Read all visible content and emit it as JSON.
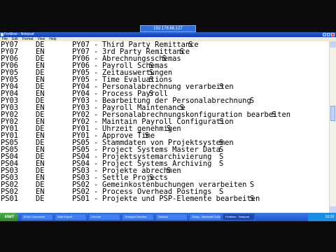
{
  "remote_session": {
    "title": "192.178.68.127"
  },
  "window": {
    "title": "Fertiliser - Notepad",
    "menus": [
      "File",
      "Edit",
      "Format",
      "View",
      "Help"
    ]
  },
  "rows": [
    {
      "code": "PY07",
      "lang": "DE",
      "code2": "PY07",
      "desc": "Third Party Remittance",
      "flag": "S",
      "flag_col": 43
    },
    {
      "code": "PY07",
      "lang": "EN",
      "code2": "PY07",
      "desc": "3rd Party Remittance",
      "flag": "S",
      "flag_col": 41
    },
    {
      "code": "PY06",
      "lang": "DE",
      "code2": "PY06",
      "desc": "Abrechnungsschemas",
      "flag": "S",
      "flag_col": 37
    },
    {
      "code": "PY06",
      "lang": "EN",
      "code2": "PY06",
      "desc": "Payroll Schemas",
      "flag": "S",
      "flag_col": 34
    },
    {
      "code": "PY05",
      "lang": "DE",
      "code2": "PY05",
      "desc": "Zeitauswertungen",
      "flag": "S",
      "flag_col": 34
    },
    {
      "code": "PY05",
      "lang": "EN",
      "code2": "PY05",
      "desc": "Time Evaluations",
      "flag": "S",
      "flag_col": 34
    },
    {
      "code": "PY04",
      "lang": "DE",
      "code2": "PY04",
      "desc": "Personalabrechnung verarbeiten",
      "flag": "S",
      "flag_col": 50
    },
    {
      "code": "PY04",
      "lang": "EN",
      "code2": "PY04",
      "desc": "Process Payroll",
      "flag": "S",
      "flag_col": 34
    },
    {
      "code": "PY03",
      "lang": "DE",
      "code2": "PY03",
      "desc": "Bearbeitung der Personalabrechnung",
      "flag": "S",
      "flag_col": 57
    },
    {
      "code": "PY03",
      "lang": "EN",
      "code2": "PY03",
      "desc": "Payroll Maintenance",
      "flag": "S",
      "flag_col": 41
    },
    {
      "code": "PY02",
      "lang": "DE",
      "code2": "PY02",
      "desc": "Personalabrechnungskonfiguration bearbeiten",
      "flag": "S",
      "flag_col": 62
    },
    {
      "code": "PY02",
      "lang": "EN",
      "code2": "PY02",
      "desc": "Maintain Payroll Configuration",
      "flag": "S",
      "flag_col": 50
    },
    {
      "code": "PY01",
      "lang": "DE",
      "code2": "PY01",
      "desc": "Uhrzeit genehmigen",
      "flag": "S",
      "flag_col": 38
    },
    {
      "code": "PY01",
      "lang": "EN",
      "code2": "PY01",
      "desc": "Approve Time",
      "flag": "S",
      "flag_col": 33
    },
    {
      "code": "PS05",
      "lang": "DE",
      "code2": "PS05",
      "desc": "Stammdaten von Projektsystemen",
      "flag": "S",
      "flag_col": 50
    },
    {
      "code": "PS05",
      "lang": "EN",
      "code2": "PS05",
      "desc": "Project Systems Master Data",
      "flag": "S",
      "flag_col": 50
    },
    {
      "code": "PS04",
      "lang": "DE",
      "code2": "PS04",
      "desc": "Projektsystemarchivierung",
      "flag": "S",
      "flag_col": 50
    },
    {
      "code": "PS04",
      "lang": "EN",
      "code2": "PS04",
      "desc": "Project Systems Archiving",
      "flag": "S",
      "flag_col": 50
    },
    {
      "code": "PS03",
      "lang": "DE",
      "code2": "PS03",
      "desc": "Projekte abrechnen",
      "flag": "S",
      "flag_col": 38
    },
    {
      "code": "PS03",
      "lang": "EN",
      "code2": "PS03",
      "desc": "Settle Projects",
      "flag": "S",
      "flag_col": 34
    },
    {
      "code": "PS02",
      "lang": "DE",
      "code2": "PS02",
      "desc": "Gemeinkostenbuchungen verarbeiten",
      "flag": "S",
      "flag_col": 57
    },
    {
      "code": "PS02",
      "lang": "EN",
      "code2": "PS02",
      "desc": "Process Overhead Postings",
      "flag": "S",
      "flag_col": 50
    },
    {
      "code": "PS01",
      "lang": "DE",
      "code2": "PS01",
      "desc": "Projekte und PSP-Elemente bearbeiten",
      "flag": "S",
      "flag_col": 57
    }
  ],
  "taskbar": {
    "start_label": "start",
    "tasks": [
      "Excel Comments",
      "Start Export",
      "Chrome",
      "Transport Monitor",
      "Outlook",
      "Today - Microsoft Outlook",
      "Fertiliser - Notepad"
    ],
    "clock": "10:33"
  }
}
